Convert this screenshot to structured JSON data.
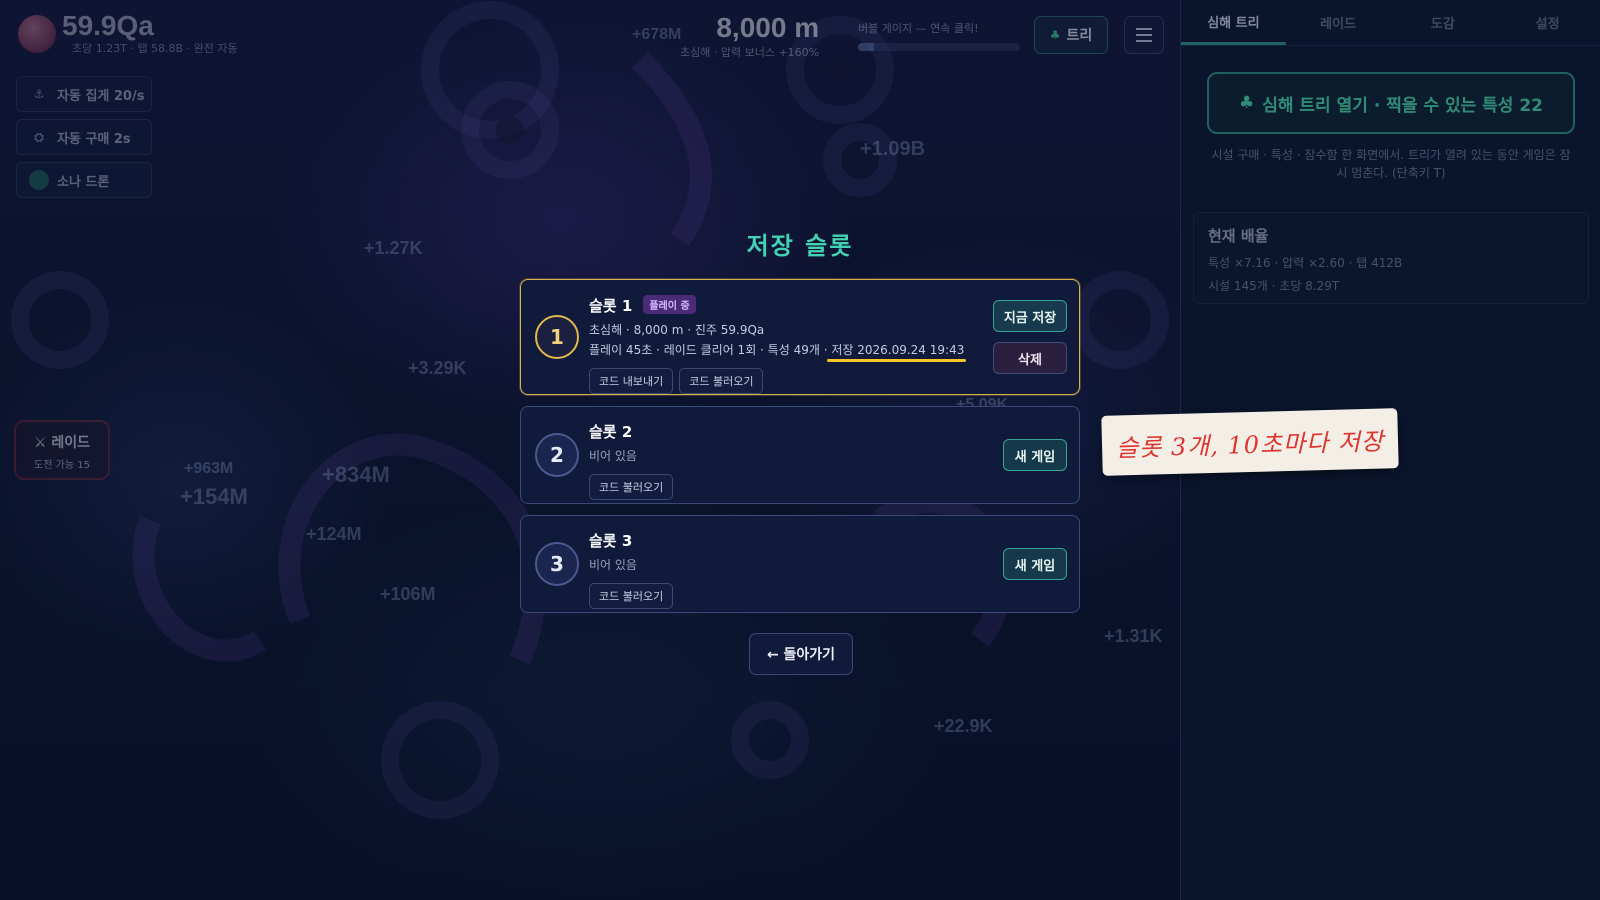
{
  "hud": {
    "pearls": "59.9Qa",
    "pearls_sub": "초당 1.23T · 탭 58.8B · 완전 자동",
    "depth": "8,000 m",
    "depth_sub": "초심해 · 압력 보너스 +160%",
    "bubble_label": "버블 게이지 — 연속 클릭!",
    "bubble_fill": 0.1,
    "tree_button": "트리"
  },
  "boosters": [
    {
      "label": "자동 집게 20/s",
      "icon": "claw-icon"
    },
    {
      "label": "자동 구매 2s",
      "icon": "cart-icon"
    },
    {
      "label": "소나 드론",
      "icon": "sonar-drone-icon"
    }
  ],
  "raid_button": {
    "label": "레이드",
    "sub": "도전 가능 15"
  },
  "floats": [
    "+678M",
    "+1.09B",
    "+1.27K",
    "+3.29K",
    "+963M",
    "+154M",
    "+834M",
    "+124M",
    "+106M",
    "+1.31K",
    "+22.9K",
    "+5.09K"
  ],
  "side_panel": {
    "tabs": [
      "심해 트리",
      "레이드",
      "도감",
      "설정"
    ],
    "active_tab": 0,
    "tree_open": "심해 트리 열기 · 찍을 수 있는 특성 22",
    "tree_desc": "시설 구매 · 특성 · 잠수함 한 화면에서. 트리가 열려 있는 동안 게임은 잠시 멈춘다. (단축키 T)",
    "current_title": "현재 배율",
    "current_line1": "특성 ×7.16 · 압력 ×2.60 · 탭 412B",
    "current_line2": "시설 145개 · 초당 8.29T"
  },
  "modal": {
    "title": "저장 슬롯",
    "slots": [
      {
        "num": "1",
        "name": "슬롯 1",
        "badge": "플레이 중",
        "line1": "초심해 · 8,000 m · 진주 59.9Qa",
        "line2": "플레이 45초 · 레이드 클리어 1회 · 특성 49개 ·",
        "save_time": "저장 2026.09.24 19:43",
        "code_buttons": [
          "코드 내보내기",
          "코드 불러오기"
        ],
        "actions": [
          "지금 저장",
          "삭제"
        ]
      },
      {
        "num": "2",
        "name": "슬롯 2",
        "line1": "비어 있음",
        "code_buttons": [
          "코드 불러오기"
        ],
        "actions": [
          "새 게임"
        ]
      },
      {
        "num": "3",
        "name": "슬롯 3",
        "line1": "비어 있음",
        "code_buttons": [
          "코드 불러오기"
        ],
        "actions": [
          "새 게임"
        ]
      }
    ],
    "back": "← 돌아가기"
  },
  "note": "슬롯 3개, 10초마다 저장",
  "colors": {
    "accent": "#43d3b4",
    "active_border": "#d8b14a",
    "note_text": "#e0332e",
    "highlight": "#f5c621"
  }
}
